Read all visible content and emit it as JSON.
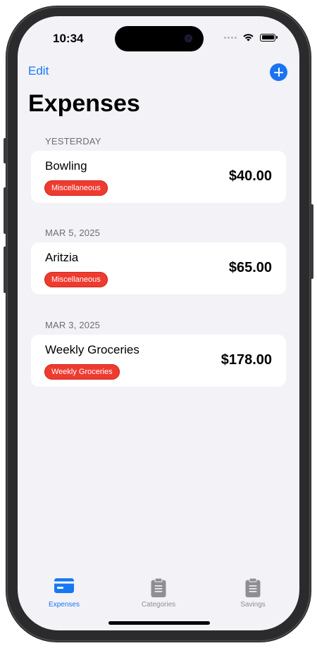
{
  "status_bar": {
    "time": "10:34"
  },
  "nav": {
    "edit_label": "Edit",
    "add_icon": "plus-circle-icon",
    "title": "Expenses"
  },
  "sections": [
    {
      "header": "YESTERDAY",
      "items": [
        {
          "name": "Bowling",
          "category": "Miscellaneous",
          "amount": "$40.00"
        }
      ]
    },
    {
      "header": "MAR 5, 2025",
      "items": [
        {
          "name": "Aritzia",
          "category": "Miscellaneous",
          "amount": "$65.00"
        }
      ]
    },
    {
      "header": "MAR 3, 2025",
      "items": [
        {
          "name": "Weekly Groceries",
          "category": "Weekly Groceries",
          "amount": "$178.00"
        }
      ]
    }
  ],
  "tab_bar": {
    "tabs": [
      {
        "label": "Expenses",
        "icon": "credit-card-icon",
        "selected": true
      },
      {
        "label": "Categories",
        "icon": "clipboard-icon",
        "selected": false
      },
      {
        "label": "Savings",
        "icon": "clipboard-icon",
        "selected": false
      }
    ]
  },
  "colors": {
    "accent": "#1877F2",
    "badge": "#EE3B30",
    "background": "#F2F2F7",
    "card": "#FFFFFF",
    "tab_inactive": "#8E8E93"
  }
}
